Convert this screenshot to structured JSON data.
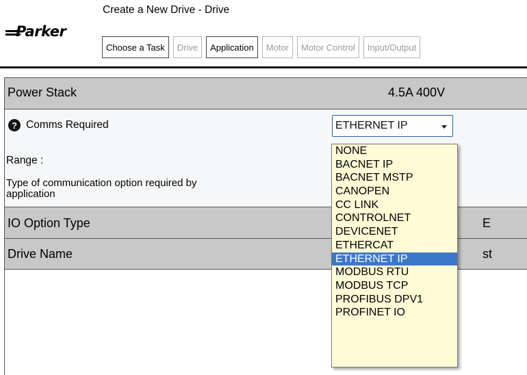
{
  "header": {
    "logo_text": "Parker",
    "title": "Create a New Drive - Drive",
    "tabs": [
      {
        "label": "Choose a Task",
        "enabled": true
      },
      {
        "label": "Drive",
        "enabled": false
      },
      {
        "label": "Application",
        "enabled": true
      },
      {
        "label": "Motor",
        "enabled": false
      },
      {
        "label": "Motor Control",
        "enabled": false
      },
      {
        "label": "Input/Output",
        "enabled": false
      }
    ]
  },
  "panel": {
    "power_stack": {
      "label": "Power Stack",
      "value": "4.5A 400V"
    },
    "comms": {
      "help_icon": "?",
      "label": "Comms Required",
      "selected": "ETHERNET IP",
      "range_label": "Range  :",
      "description": "Type of communication option required by application"
    },
    "io_option": {
      "label": "IO Option Type",
      "value_fragment": "E"
    },
    "drive_name": {
      "label": "Drive Name",
      "value_fragment": "st"
    }
  },
  "dropdown": {
    "options": [
      "NONE",
      "BACNET IP",
      "BACNET MSTP",
      "CANOPEN",
      "CC LINK",
      "CONTROLNET",
      "DEVICENET",
      "ETHERCAT",
      "ETHERNET IP",
      "MODBUS RTU",
      "MODBUS TCP",
      "PROFIBUS DPV1",
      "PROFINET IO"
    ],
    "selected_index": 8
  },
  "colors": {
    "row_gray": "#c8c8c8",
    "dropdown_bg": "#fffbd7",
    "selected_bg": "#3c78c8",
    "select_border": "#2a5fa8"
  }
}
